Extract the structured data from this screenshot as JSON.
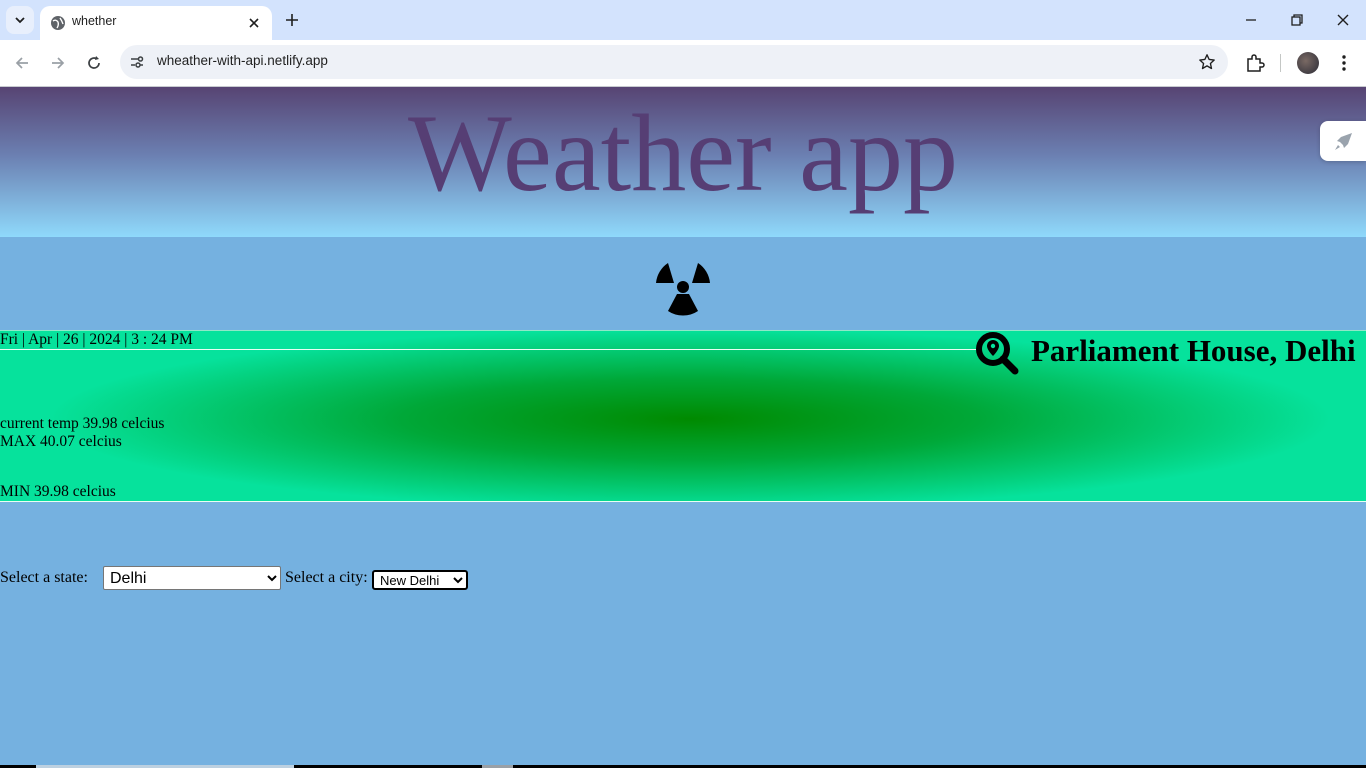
{
  "browser": {
    "tab_title": "whether",
    "url": "wheather-with-api.netlify.app"
  },
  "header": {
    "title": "Weather app"
  },
  "weather": {
    "datetime": "Fri | Apr | 26 | 2024 | 3 : 24 PM",
    "location": "Parliament House, Delhi",
    "current_temp": "current temp 39.98 celcius",
    "max_temp": "MAX 40.07 celcius",
    "min_temp": "MIN 39.98 celcius"
  },
  "form": {
    "state_label": "Select a state:",
    "state_value": "Delhi",
    "city_label": "Select a city:",
    "city_value": "New Delhi"
  },
  "icons": {
    "weather": "radiation-hazard-icon",
    "location": "location-search-icon",
    "widget": "rocket-icon"
  },
  "colors": {
    "title": "#563e74",
    "page_bg": "#75b1e0",
    "band_center": "#008a00",
    "band_edge": "#06e29c"
  }
}
